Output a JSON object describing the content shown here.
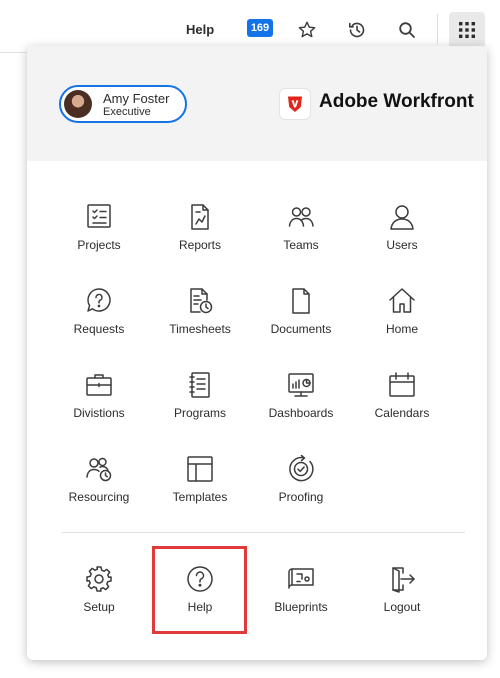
{
  "topbar": {
    "help_label": "Help",
    "notification_count": "169"
  },
  "user": {
    "name": "Amy Foster",
    "role": "Executive"
  },
  "brand": {
    "name": "Adobe Workfront",
    "accent": "#e1251b"
  },
  "apps": [
    {
      "label": "Projects",
      "icon": "projects-icon"
    },
    {
      "label": "Reports",
      "icon": "reports-icon"
    },
    {
      "label": "Teams",
      "icon": "teams-icon"
    },
    {
      "label": "Users",
      "icon": "users-icon"
    },
    {
      "label": "Requests",
      "icon": "requests-icon"
    },
    {
      "label": "Timesheets",
      "icon": "timesheets-icon"
    },
    {
      "label": "Documents",
      "icon": "documents-icon"
    },
    {
      "label": "Home",
      "icon": "home-icon"
    },
    {
      "label": "Divistions",
      "icon": "divisions-icon"
    },
    {
      "label": "Programs",
      "icon": "programs-icon"
    },
    {
      "label": "Dashboards",
      "icon": "dashboards-icon"
    },
    {
      "label": "Calendars",
      "icon": "calendars-icon"
    },
    {
      "label": "Resourcing",
      "icon": "resourcing-icon"
    },
    {
      "label": "Templates",
      "icon": "templates-icon"
    },
    {
      "label": "Proofing",
      "icon": "proofing-icon"
    }
  ],
  "footer_items": [
    {
      "label": "Setup",
      "icon": "setup-icon"
    },
    {
      "label": "Help",
      "icon": "help-icon"
    },
    {
      "label": "Blueprints",
      "icon": "blueprints-icon"
    },
    {
      "label": "Logout",
      "icon": "logout-icon"
    }
  ],
  "colors": {
    "accent_blue": "#1473e6",
    "highlight_red": "#e03a3a"
  }
}
